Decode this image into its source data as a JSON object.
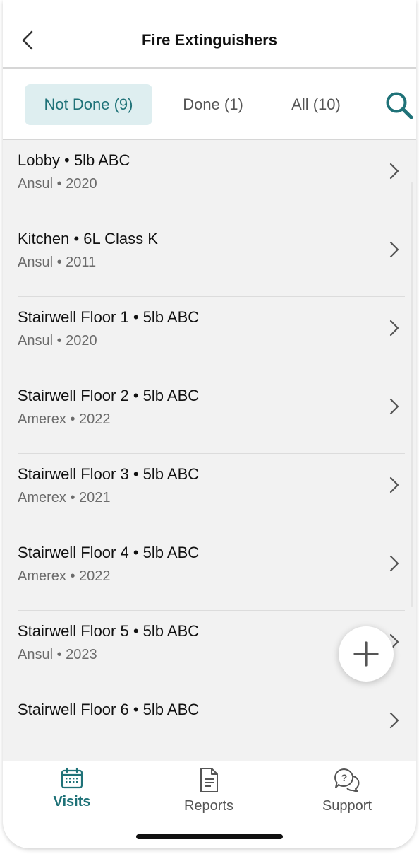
{
  "header": {
    "title": "Fire Extinguishers"
  },
  "filters": [
    {
      "label": "Not Done (9)",
      "active": true
    },
    {
      "label": "Done (1)",
      "active": false
    },
    {
      "label": "All (10)",
      "active": false
    }
  ],
  "items": [
    {
      "title": "Lobby • 5lb ABC",
      "subtitle": "Ansul • 2020"
    },
    {
      "title": "Kitchen • 6L Class K",
      "subtitle": "Ansul • 2011"
    },
    {
      "title": "Stairwell Floor 1 • 5lb ABC",
      "subtitle": "Ansul • 2020"
    },
    {
      "title": "Stairwell Floor 2 • 5lb ABC",
      "subtitle": "Amerex • 2022"
    },
    {
      "title": "Stairwell Floor 3 • 5lb ABC",
      "subtitle": "Amerex • 2021"
    },
    {
      "title": "Stairwell Floor 4 • 5lb ABC",
      "subtitle": "Amerex • 2022"
    },
    {
      "title": "Stairwell Floor 5 • 5lb ABC",
      "subtitle": "Ansul • 2023"
    },
    {
      "title": "Stairwell Floor 6 • 5lb ABC",
      "subtitle": ""
    }
  ],
  "tabbar": {
    "visits": "Visits",
    "reports": "Reports",
    "support": "Support"
  },
  "icons": {
    "back": "chevron-left-icon",
    "search": "search-icon",
    "row": "chevron-right-icon",
    "add": "plus-icon",
    "visits": "calendar-icon",
    "reports": "document-icon",
    "support": "chat-question-icon"
  },
  "colors": {
    "accent": "#1f7278",
    "active_tab_bg": "#deeef0",
    "list_bg": "#f2f2f2"
  }
}
